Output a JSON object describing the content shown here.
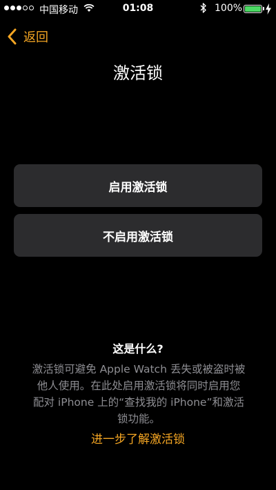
{
  "status_bar": {
    "carrier": "中国移动",
    "time": "01:08",
    "battery_percent": "100%",
    "signal_bars_filled": 3,
    "signal_bars_total": 5,
    "battery_level": 1.0,
    "battery_color": "#4cd964"
  },
  "nav": {
    "back_label": "返回"
  },
  "page": {
    "title": "激活锁"
  },
  "actions": {
    "enable_label": "启用激活锁",
    "disable_label": "不启用激活锁"
  },
  "info": {
    "heading": "这是什么?",
    "body_lines": [
      "激活锁可避免 Apple Watch 丢失或被盗时被",
      "他人使用。在此处启用激活锁将同时启用您",
      "配对 iPhone 上的“查找我的 iPhone”和激活",
      "锁功能。"
    ],
    "learn_more": "进一步了解激活锁"
  },
  "colors": {
    "accent": "#f5a623",
    "background": "#000000",
    "button_bg": "#2c2c2e",
    "secondary_text": "#8e8e93"
  }
}
